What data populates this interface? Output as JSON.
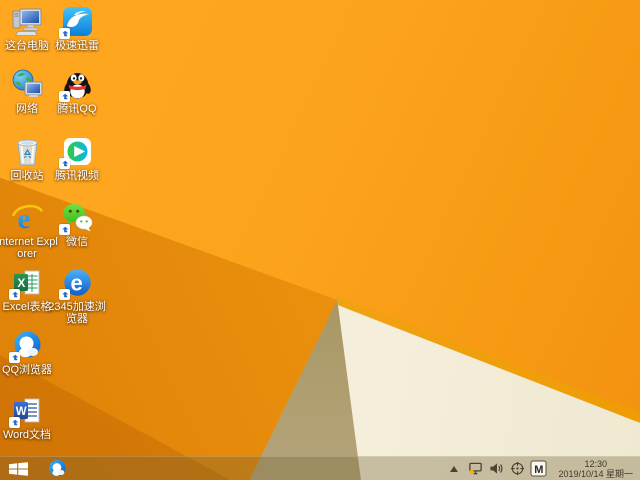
{
  "wallpaper": {
    "base_orange": "#fca31c",
    "cream": "#f4eedb",
    "khaki": "#a6955f",
    "amber_edge": "#ef9c05"
  },
  "desktop": {
    "icons": [
      {
        "name": "this-pc",
        "label": "这台电脑"
      },
      {
        "name": "xunlei-speed",
        "label": "极速迅雷"
      },
      {
        "name": "network",
        "label": "网络"
      },
      {
        "name": "tencent-qq",
        "label": "腾讯QQ"
      },
      {
        "name": "recycle-bin",
        "label": "回收站"
      },
      {
        "name": "tencent-video",
        "label": "腾讯视频"
      },
      {
        "name": "internet-explorer",
        "label": "Internet Explorer"
      },
      {
        "name": "wechat",
        "label": "微信"
      },
      {
        "name": "excel",
        "label": "Excel表格"
      },
      {
        "name": "2345-browser",
        "label": "2345加速浏览器"
      },
      {
        "name": "qq-browser",
        "label": "QQ浏览器"
      },
      {
        "name": "word",
        "label": "Word文档"
      }
    ],
    "logo_letters": {
      "ie": "e",
      "excel": "X",
      "browser2345": "e",
      "word": "W"
    }
  },
  "taskbar": {
    "start": "start-button",
    "pinned": [
      "qq-browser"
    ],
    "tray_icons": [
      "hidden-icons-chevron",
      "network-warning",
      "volume",
      "app-circle",
      "ime-indicator"
    ],
    "ime_indicator": "M",
    "clock": {
      "time": "12:30",
      "date": "2019/10/14 星期一"
    }
  }
}
